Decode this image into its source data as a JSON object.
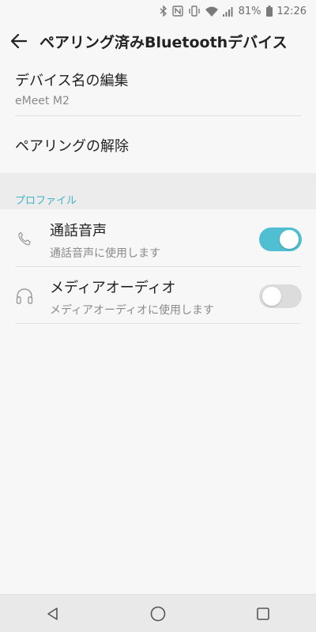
{
  "status_bar": {
    "battery_percent": "81%",
    "time": "12:26"
  },
  "app_bar": {
    "title": "ペアリング済みBluetoothデバイス"
  },
  "device": {
    "rename_label": "デバイス名の編集",
    "device_name": "eMeet M2",
    "unpair_label": "ペアリングの解除"
  },
  "profiles": {
    "header": "プロファイル",
    "items": [
      {
        "title": "通話音声",
        "subtitle": "通話音声に使用します",
        "icon": "phone-icon",
        "enabled": true
      },
      {
        "title": "メディアオーディオ",
        "subtitle": "メディアオーディオに使用します",
        "icon": "headphones-icon",
        "enabled": false
      }
    ]
  },
  "colors": {
    "accent": "#4fbfd1",
    "section_header": "#41b5c8",
    "toggle_off": "#dcdcdc"
  }
}
